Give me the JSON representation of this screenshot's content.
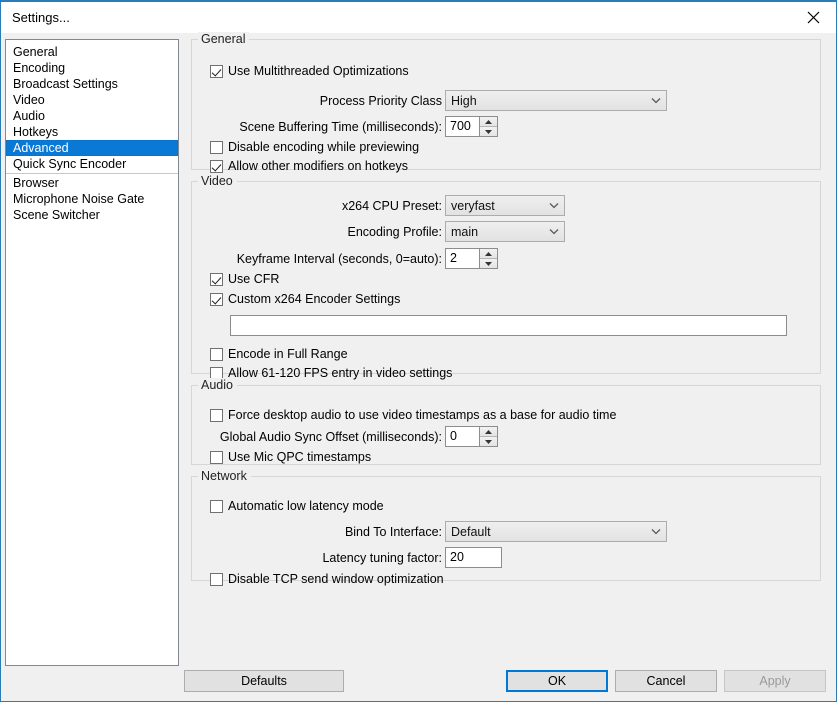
{
  "window": {
    "title": "Settings...",
    "close_icon": "close-icon",
    "accent_color": "#0a79d6"
  },
  "sidebar": {
    "items": [
      {
        "label": "General",
        "selected": false
      },
      {
        "label": "Encoding",
        "selected": false
      },
      {
        "label": "Broadcast Settings",
        "selected": false
      },
      {
        "label": "Video",
        "selected": false
      },
      {
        "label": "Audio",
        "selected": false
      },
      {
        "label": "Hotkeys",
        "selected": false
      },
      {
        "label": "Advanced",
        "selected": true
      },
      {
        "label": "Quick Sync Encoder",
        "selected": false
      },
      {
        "label": "Browser",
        "selected": false
      },
      {
        "label": "Microphone Noise Gate",
        "selected": false
      },
      {
        "label": "Scene Switcher",
        "selected": false
      }
    ],
    "separator_after_index": 7
  },
  "general": {
    "title": "General",
    "use_multithreaded_label": "Use Multithreaded Optimizations",
    "use_multithreaded_checked": "true",
    "process_priority_label": "Process Priority Class",
    "process_priority_value": "High",
    "scene_buffering_label": "Scene Buffering Time (milliseconds):",
    "scene_buffering_value": "700",
    "disable_encoding_label": "Disable encoding while previewing",
    "disable_encoding_checked": "false",
    "allow_modifiers_label": "Allow other modifiers on hotkeys",
    "allow_modifiers_checked": "true"
  },
  "video": {
    "title": "Video",
    "cpu_preset_label": "x264 CPU Preset:",
    "cpu_preset_value": "veryfast",
    "encoding_profile_label": "Encoding Profile:",
    "encoding_profile_value": "main",
    "keyframe_label": "Keyframe Interval (seconds, 0=auto):",
    "keyframe_value": "2",
    "use_cfr_label": "Use CFR",
    "use_cfr_checked": "true",
    "custom_x264_label": "Custom x264 Encoder Settings",
    "custom_x264_checked": "true",
    "custom_x264_value": "",
    "encode_full_range_label": "Encode in Full Range",
    "encode_full_range_checked": "false",
    "allow_fps_label": "Allow 61-120 FPS entry in video settings",
    "allow_fps_checked": "false"
  },
  "audio": {
    "title": "Audio",
    "force_desktop_label": "Force desktop audio to use video timestamps as a base for audio time",
    "force_desktop_checked": "false",
    "global_offset_label": "Global Audio Sync Offset (milliseconds):",
    "global_offset_value": "0",
    "mic_qpc_label": "Use Mic QPC timestamps",
    "mic_qpc_checked": "false"
  },
  "network": {
    "title": "Network",
    "auto_latency_label": "Automatic low latency mode",
    "auto_latency_checked": "false",
    "bind_interface_label": "Bind To Interface:",
    "bind_interface_value": "Default",
    "latency_factor_label": "Latency tuning factor:",
    "latency_factor_value": "20",
    "disable_tcp_label": "Disable TCP send window optimization",
    "disable_tcp_checked": "false"
  },
  "footer": {
    "defaults_label": "Defaults",
    "ok_label": "OK",
    "cancel_label": "Cancel",
    "apply_label": "Apply"
  }
}
